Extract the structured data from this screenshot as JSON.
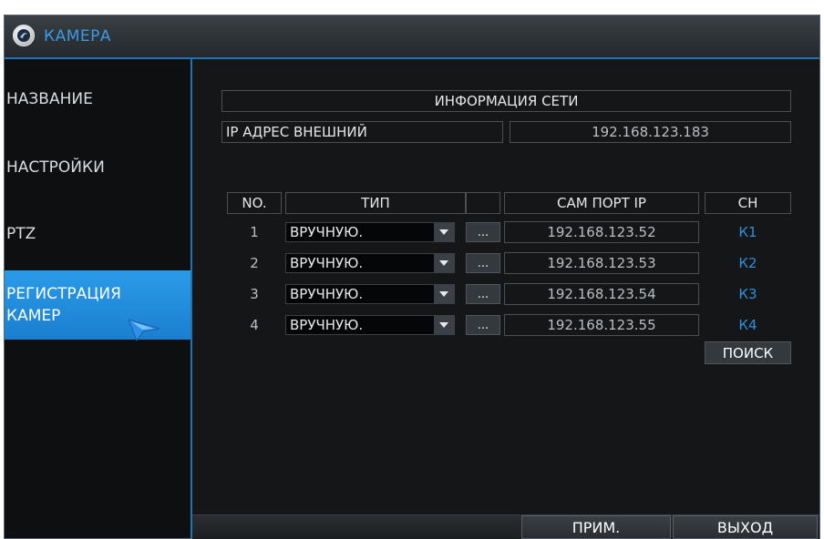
{
  "window": {
    "title": "КАМЕРА"
  },
  "sidebar": {
    "items": [
      {
        "label": "НАЗВАНИЕ"
      },
      {
        "label": "НАСТРОЙКИ"
      },
      {
        "label": "PTZ"
      },
      {
        "label": "РЕГИСТРАЦИЯ КАМЕР",
        "line1": "РЕГИСТРАЦИЯ",
        "line2": "КАМЕР",
        "active": true
      }
    ]
  },
  "network": {
    "header": "ИНФОРМАЦИЯ СЕТИ",
    "external_ip_label": "IP АДРЕС ВНЕШНИЙ",
    "external_ip_value": "192.168.123.183"
  },
  "table": {
    "headers": {
      "no": "NO.",
      "type": "ТИП",
      "cam_port_ip": "САМ ПОРТ IP",
      "ch": "CH"
    },
    "rows": [
      {
        "no": "1",
        "type": "ВРУЧНУЮ.",
        "more": "...",
        "ip": "192.168.123.52",
        "ch": "К1"
      },
      {
        "no": "2",
        "type": "ВРУЧНУЮ.",
        "more": "...",
        "ip": "192.168.123.53",
        "ch": "К2"
      },
      {
        "no": "3",
        "type": "ВРУЧНУЮ.",
        "more": "...",
        "ip": "192.168.123.54",
        "ch": "К3"
      },
      {
        "no": "4",
        "type": "ВРУЧНУЮ.",
        "more": "...",
        "ip": "192.168.123.55",
        "ch": "К4"
      }
    ]
  },
  "buttons": {
    "search": "ПОИСК",
    "apply": "ПРИМ.",
    "exit": "ВЫХОД"
  },
  "colors": {
    "accent": "#1f74b6",
    "active_item": "#2a9be8",
    "channel_text": "#2f8fdc"
  }
}
